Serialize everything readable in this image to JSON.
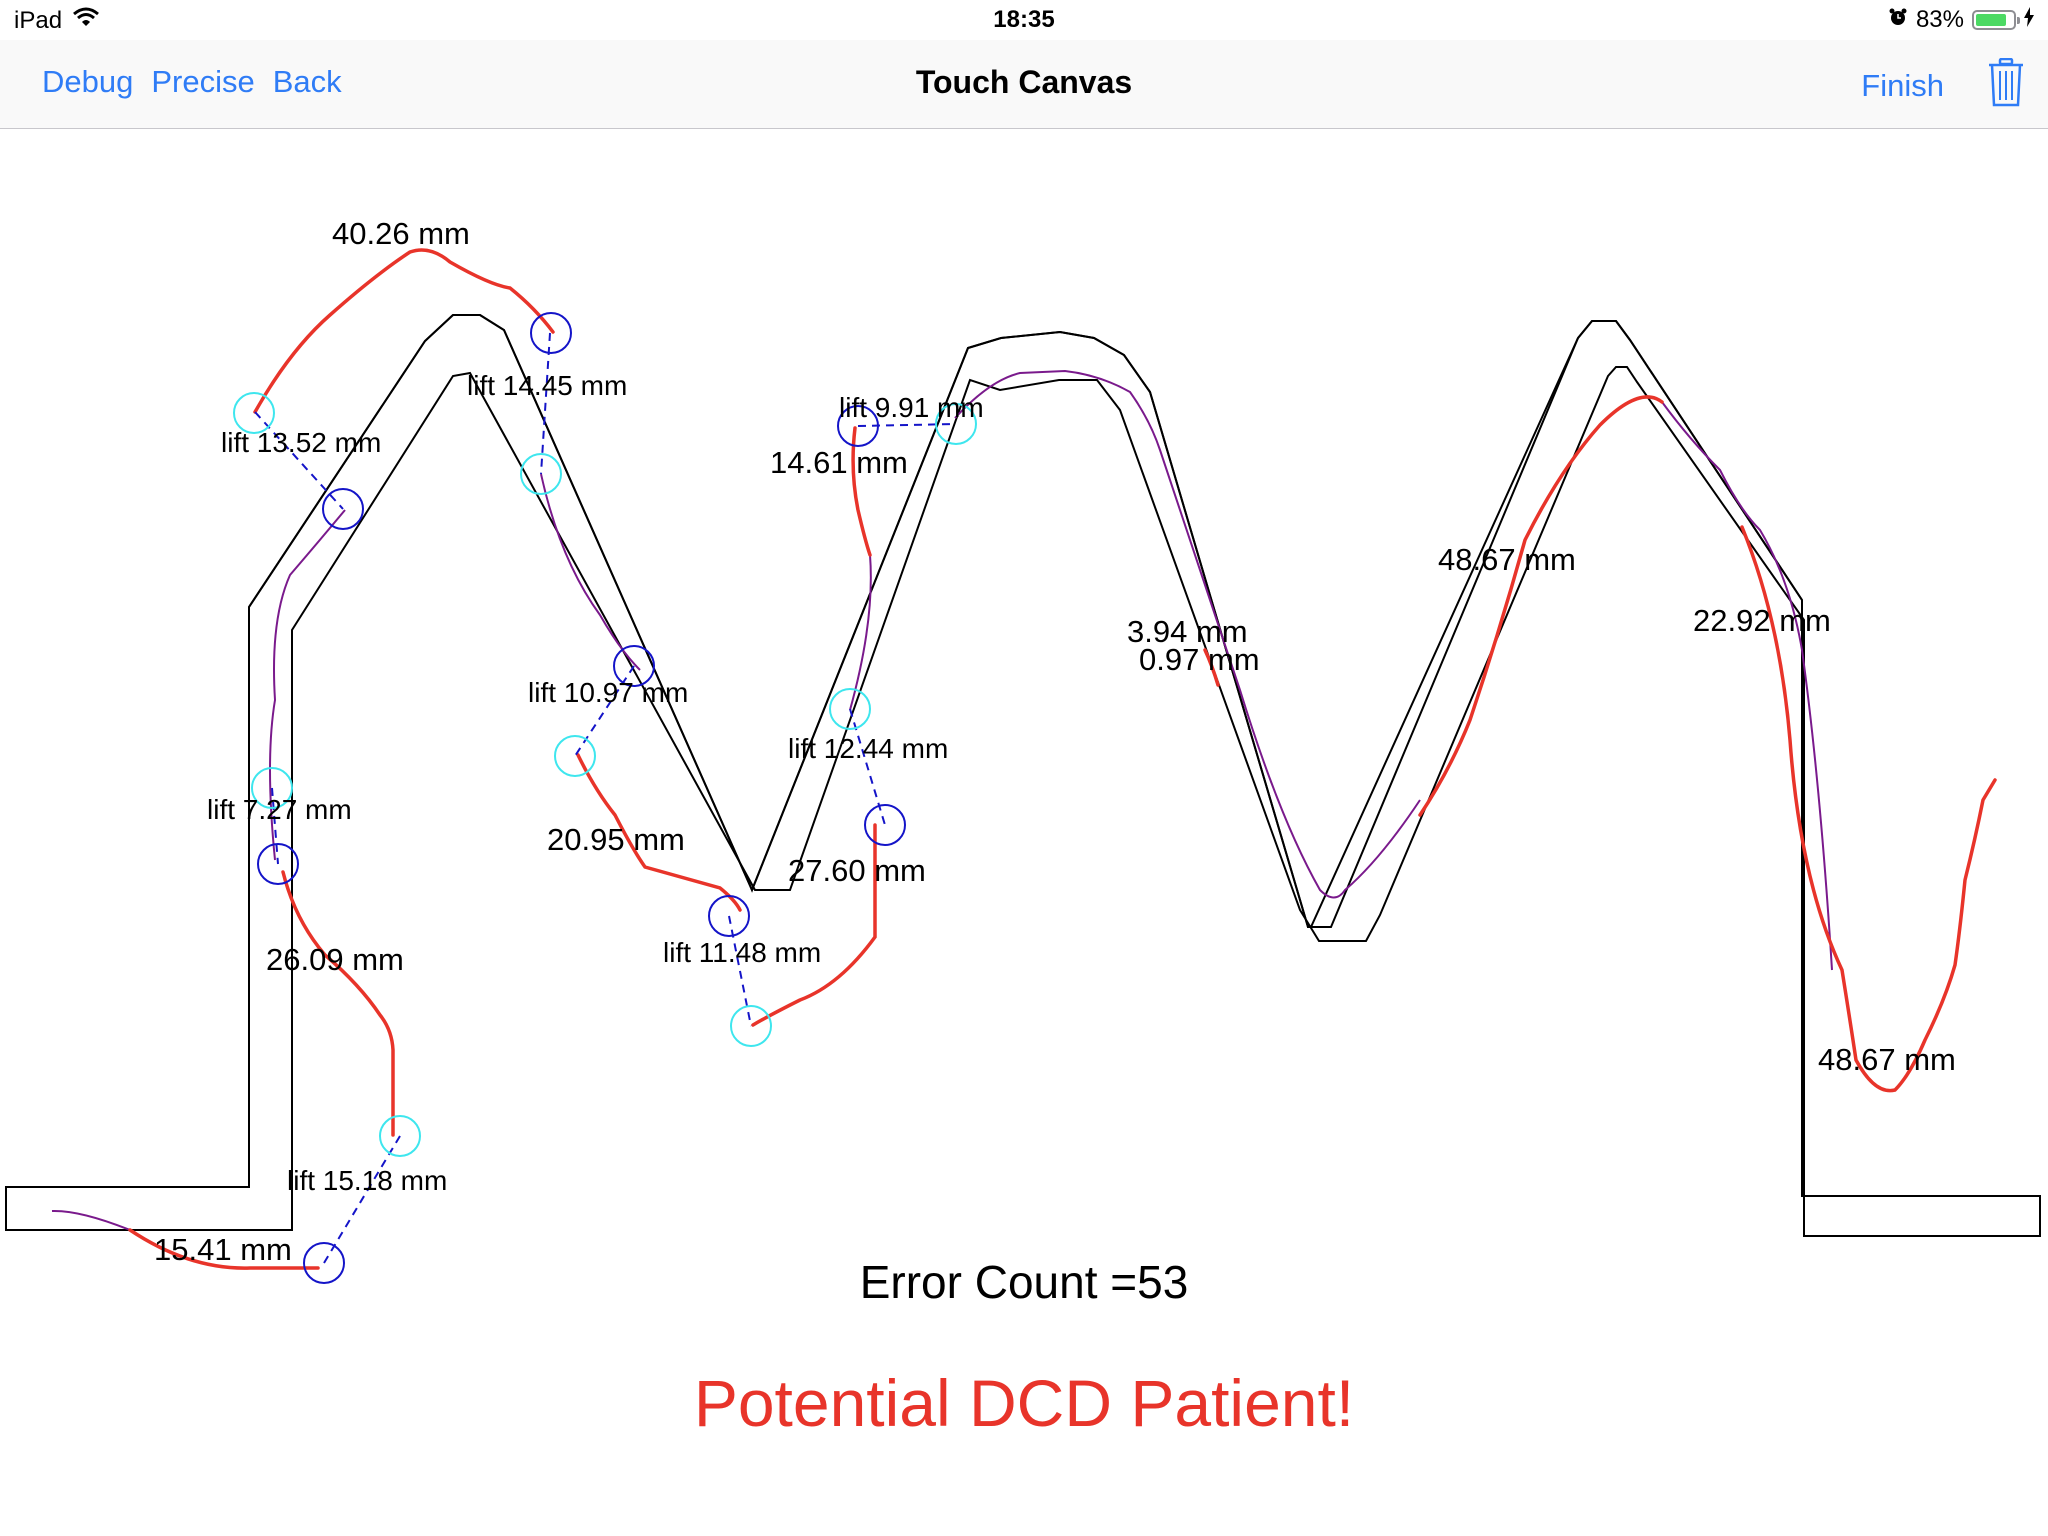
{
  "status_bar": {
    "device": "iPad",
    "time": "18:35",
    "battery": "83%",
    "battery_level": 0.83,
    "icons": [
      "wifi-icon",
      "alarm-icon",
      "battery-icon",
      "charging-icon"
    ]
  },
  "nav": {
    "left_buttons": [
      "Debug",
      "Precise",
      "Back"
    ],
    "title": "Touch Canvas",
    "finish": "Finish",
    "trash_icon": "trash-icon"
  },
  "canvas": {
    "segment_labels": [
      "40.26 mm",
      "14.61 mm",
      "20.95 mm",
      "27.60 mm",
      "26.09 mm",
      "15.41 mm",
      "3.94 mm",
      "0.97 mm",
      "48.67 mm",
      "22.92 mm",
      "48.67 mm"
    ],
    "lift_labels": [
      "lift 13.52 mm",
      "lift 14.45 mm",
      "lift 9.91 mm",
      "lift 10.97 mm",
      "lift 12.44 mm",
      "lift 7.27 mm",
      "lift 11.48 mm",
      "lift 15.18 mm"
    ]
  },
  "result": {
    "error_count": "Error Count =53",
    "verdict": "Potential DCD Patient!"
  },
  "colors": {
    "accent": "#2f7cf6",
    "stroke_red": "#e8342a",
    "trace_purple": "#7a1a8c",
    "lift_start": "#1414c8",
    "lift_end": "#3ee6ee",
    "verdict": "#e8342a"
  }
}
